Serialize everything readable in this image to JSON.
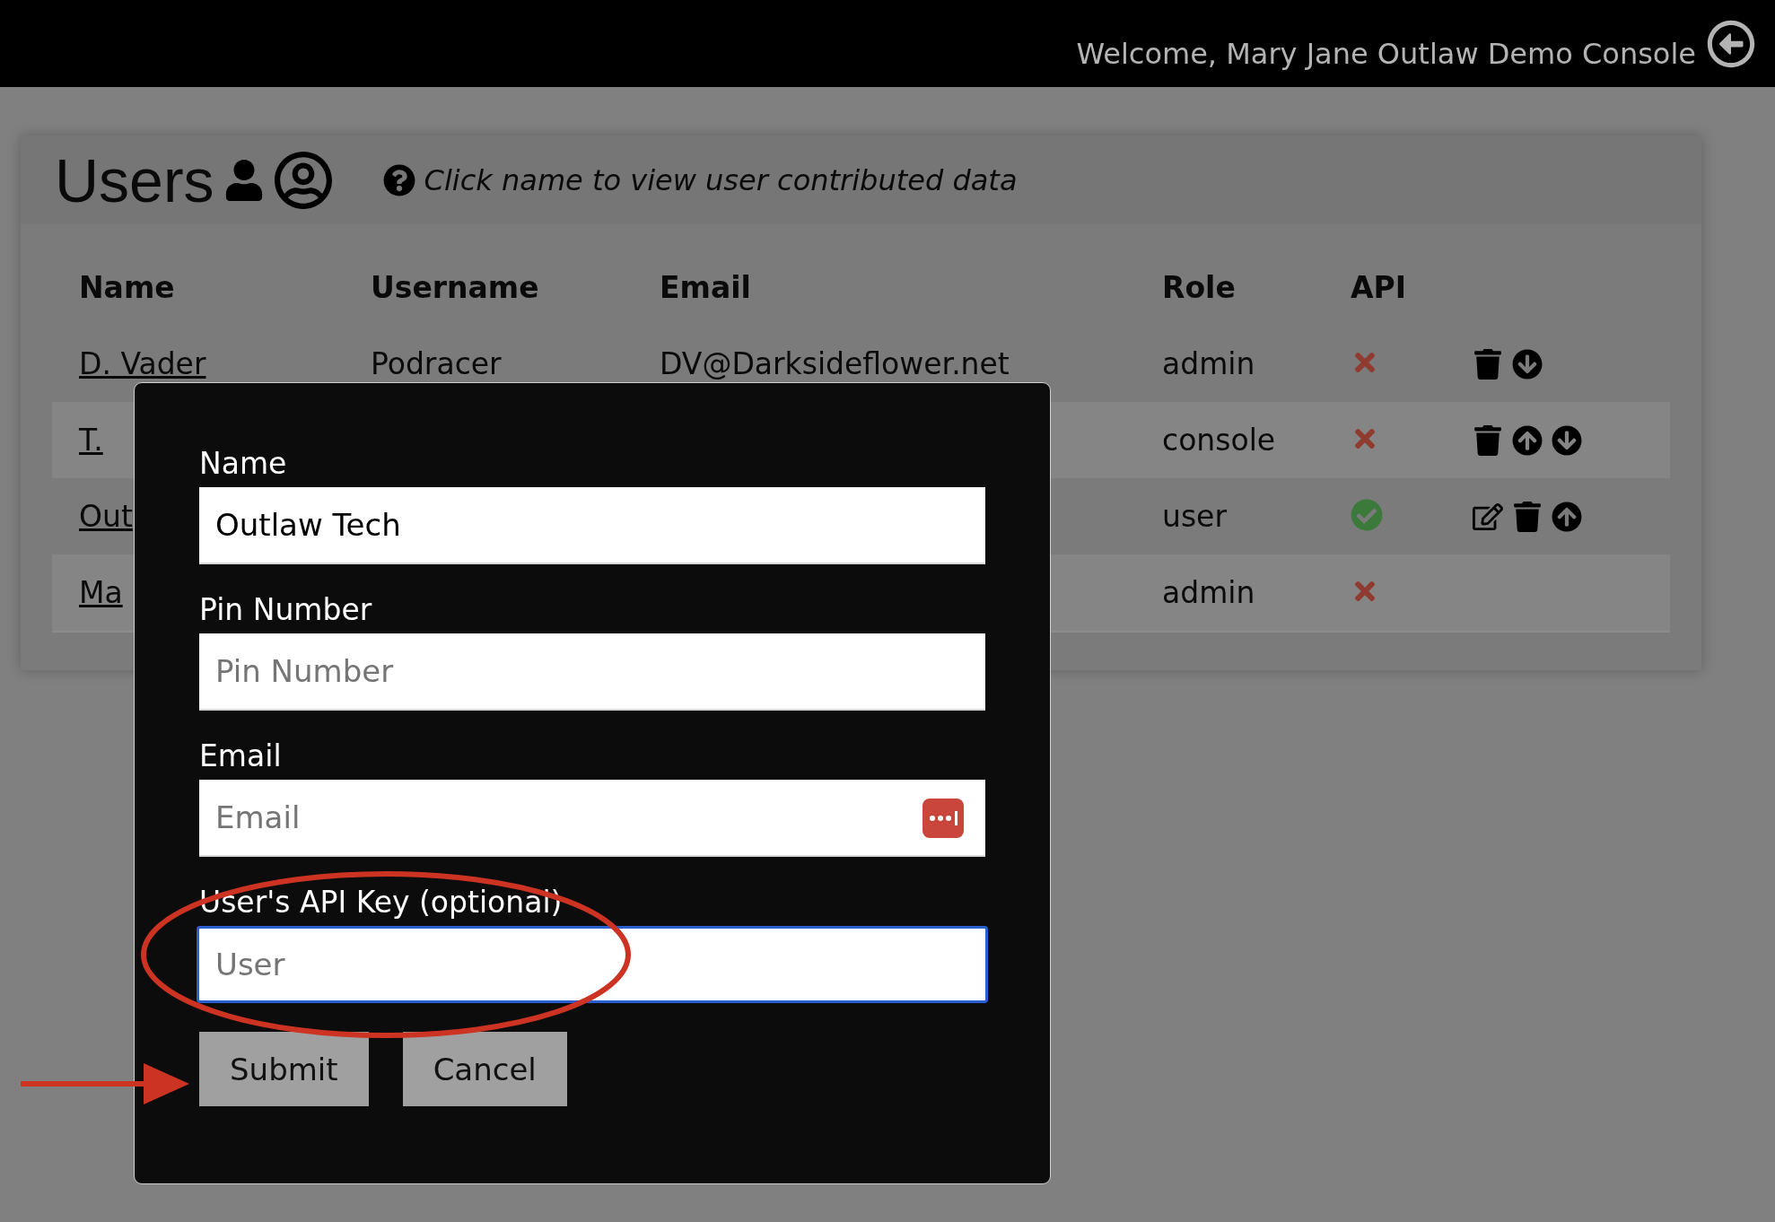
{
  "top_bar": {
    "welcome": "Welcome, Mary Jane Outlaw Demo Console"
  },
  "users_card": {
    "title": "Users",
    "help": "Click name to view user contributed data"
  },
  "table": {
    "columns": [
      "Name",
      "Username",
      "Email",
      "Role",
      "API"
    ],
    "rows": [
      {
        "name": "D. Vader",
        "username": "Podracer",
        "email": "DV@Darksideflower.net",
        "role": "admin",
        "api": false,
        "actions": [
          {
            "kind": "delete"
          },
          {
            "kind": "down"
          }
        ]
      },
      {
        "name": "T.",
        "role": "console",
        "api": false,
        "actions": [
          {
            "kind": "delete"
          },
          {
            "kind": "up"
          },
          {
            "kind": "down"
          }
        ]
      },
      {
        "name": "Out",
        "role": "user",
        "api": true,
        "actions": [
          {
            "kind": "edit"
          },
          {
            "kind": "delete"
          },
          {
            "kind": "up"
          }
        ]
      },
      {
        "name": "Ma",
        "role": "admin",
        "api": false
      }
    ]
  },
  "dialog": {
    "fields": [
      {
        "label": "Name",
        "value": "Outlaw Tech",
        "focused": false
      },
      {
        "label": "Pin Number",
        "placeholder": "Pin Number",
        "focused": false
      },
      {
        "label": "Email",
        "placeholder": "Email",
        "focused": false,
        "password_manager": true
      },
      {
        "label": "User's API Key (optional)",
        "placeholder": "User",
        "focused": true
      }
    ],
    "buttons": [
      "Submit",
      "Cancel"
    ]
  }
}
